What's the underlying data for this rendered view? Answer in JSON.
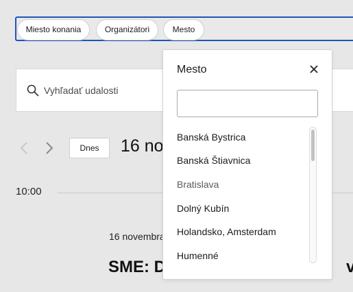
{
  "filters": {
    "chips": [
      "Miesto konania",
      "Organizátori",
      "Mesto"
    ]
  },
  "search": {
    "placeholder": "Vyhľadať udalosti"
  },
  "date_nav": {
    "today_label": "Dnes",
    "current_date": "16 no"
  },
  "timeline": {
    "time_label": "10:00"
  },
  "event": {
    "date": "16 novembra",
    "title": "SME: D",
    "title_tail": "väz"
  },
  "dropdown": {
    "title": "Mesto",
    "search_value": "",
    "options": [
      {
        "label": "Banská Bystrica",
        "muted": false
      },
      {
        "label": "Banská Štiavnica",
        "muted": false
      },
      {
        "label": "Bratislava",
        "muted": true
      },
      {
        "label": "Dolný Kubín",
        "muted": false
      },
      {
        "label": "Holandsko, Amsterdam",
        "muted": false
      },
      {
        "label": "Humenné",
        "muted": false
      }
    ]
  },
  "colors": {
    "accent_border": "#1d55b8",
    "background": "#e7e7e7"
  }
}
